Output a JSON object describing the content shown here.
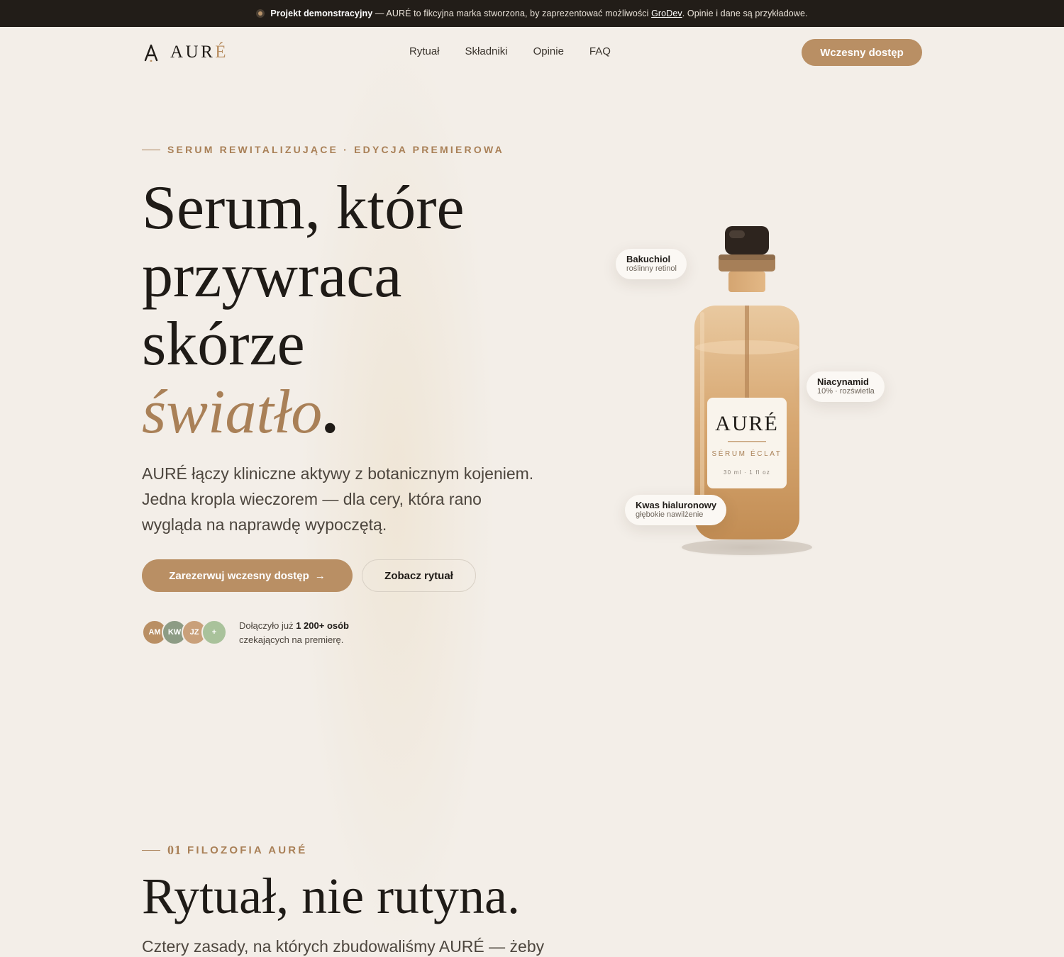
{
  "announcement": {
    "bold": "Projekt demonstracyjny",
    "text": " — AURÉ to fikcyjna marka stworzona, by zaprezentować możliwości ",
    "link": "GroDev",
    "tail": ". Opinie i dane są przykładowe."
  },
  "brand": {
    "name_main": "AUR",
    "name_accent": "É"
  },
  "nav": [
    "Rytuał",
    "Składniki",
    "Opinie",
    "FAQ"
  ],
  "header_cta": "Wczesny dostęp",
  "hero": {
    "eyebrow": "SERUM REWITALIZUJĄCE · EDYCJA PREMIEROWA",
    "headline_lines": [
      "Serum, które",
      "przywraca",
      "skórze"
    ],
    "headline_accent": "światło",
    "headline_period": ".",
    "lead": "AURÉ łączy kliniczne aktywy z botanicznym kojeniem. Jedna kropla wieczorem — dla cery, która rano wygląda na naprawdę wypoczętą.",
    "primary_cta": "Zarezerwuj wczesny dostęp",
    "primary_cta_arrow": "→",
    "secondary_cta": "Zobacz rytuał",
    "avatars": [
      {
        "initials": "AM",
        "color": "#b98f64"
      },
      {
        "initials": "KW",
        "color": "#8d9c85"
      },
      {
        "initials": "JZ",
        "color": "#c9a07a"
      },
      {
        "initials": "+",
        "color": "#a9c29b"
      }
    ],
    "social_prefix": "Dołączyło już ",
    "social_count": "1 200+ osób",
    "social_suffix": "czekających na premierę."
  },
  "product": {
    "label_brand": "AURÉ",
    "label_name": "SÉRUM ÉCLAT",
    "label_volume": "30 ml · 1 fl oz",
    "chips": [
      {
        "title": "Bakuchiol",
        "sub": "roślinny retinol"
      },
      {
        "title": "Niacynamid",
        "sub": "10% · rozświetla"
      },
      {
        "title": "Kwas hialuronowy",
        "sub": "głębokie nawilżenie"
      }
    ]
  },
  "philosophy": {
    "number": "01",
    "eyebrow": "FILOZOFIA AURÉ",
    "title": "Rytuał, nie rutyna.",
    "subtitle": "Cztery zasady, na których zbudowaliśmy AURÉ — żeby"
  },
  "colors": {
    "accent": "#b98f64",
    "background": "#f3eee8",
    "dark": "#221d18"
  }
}
